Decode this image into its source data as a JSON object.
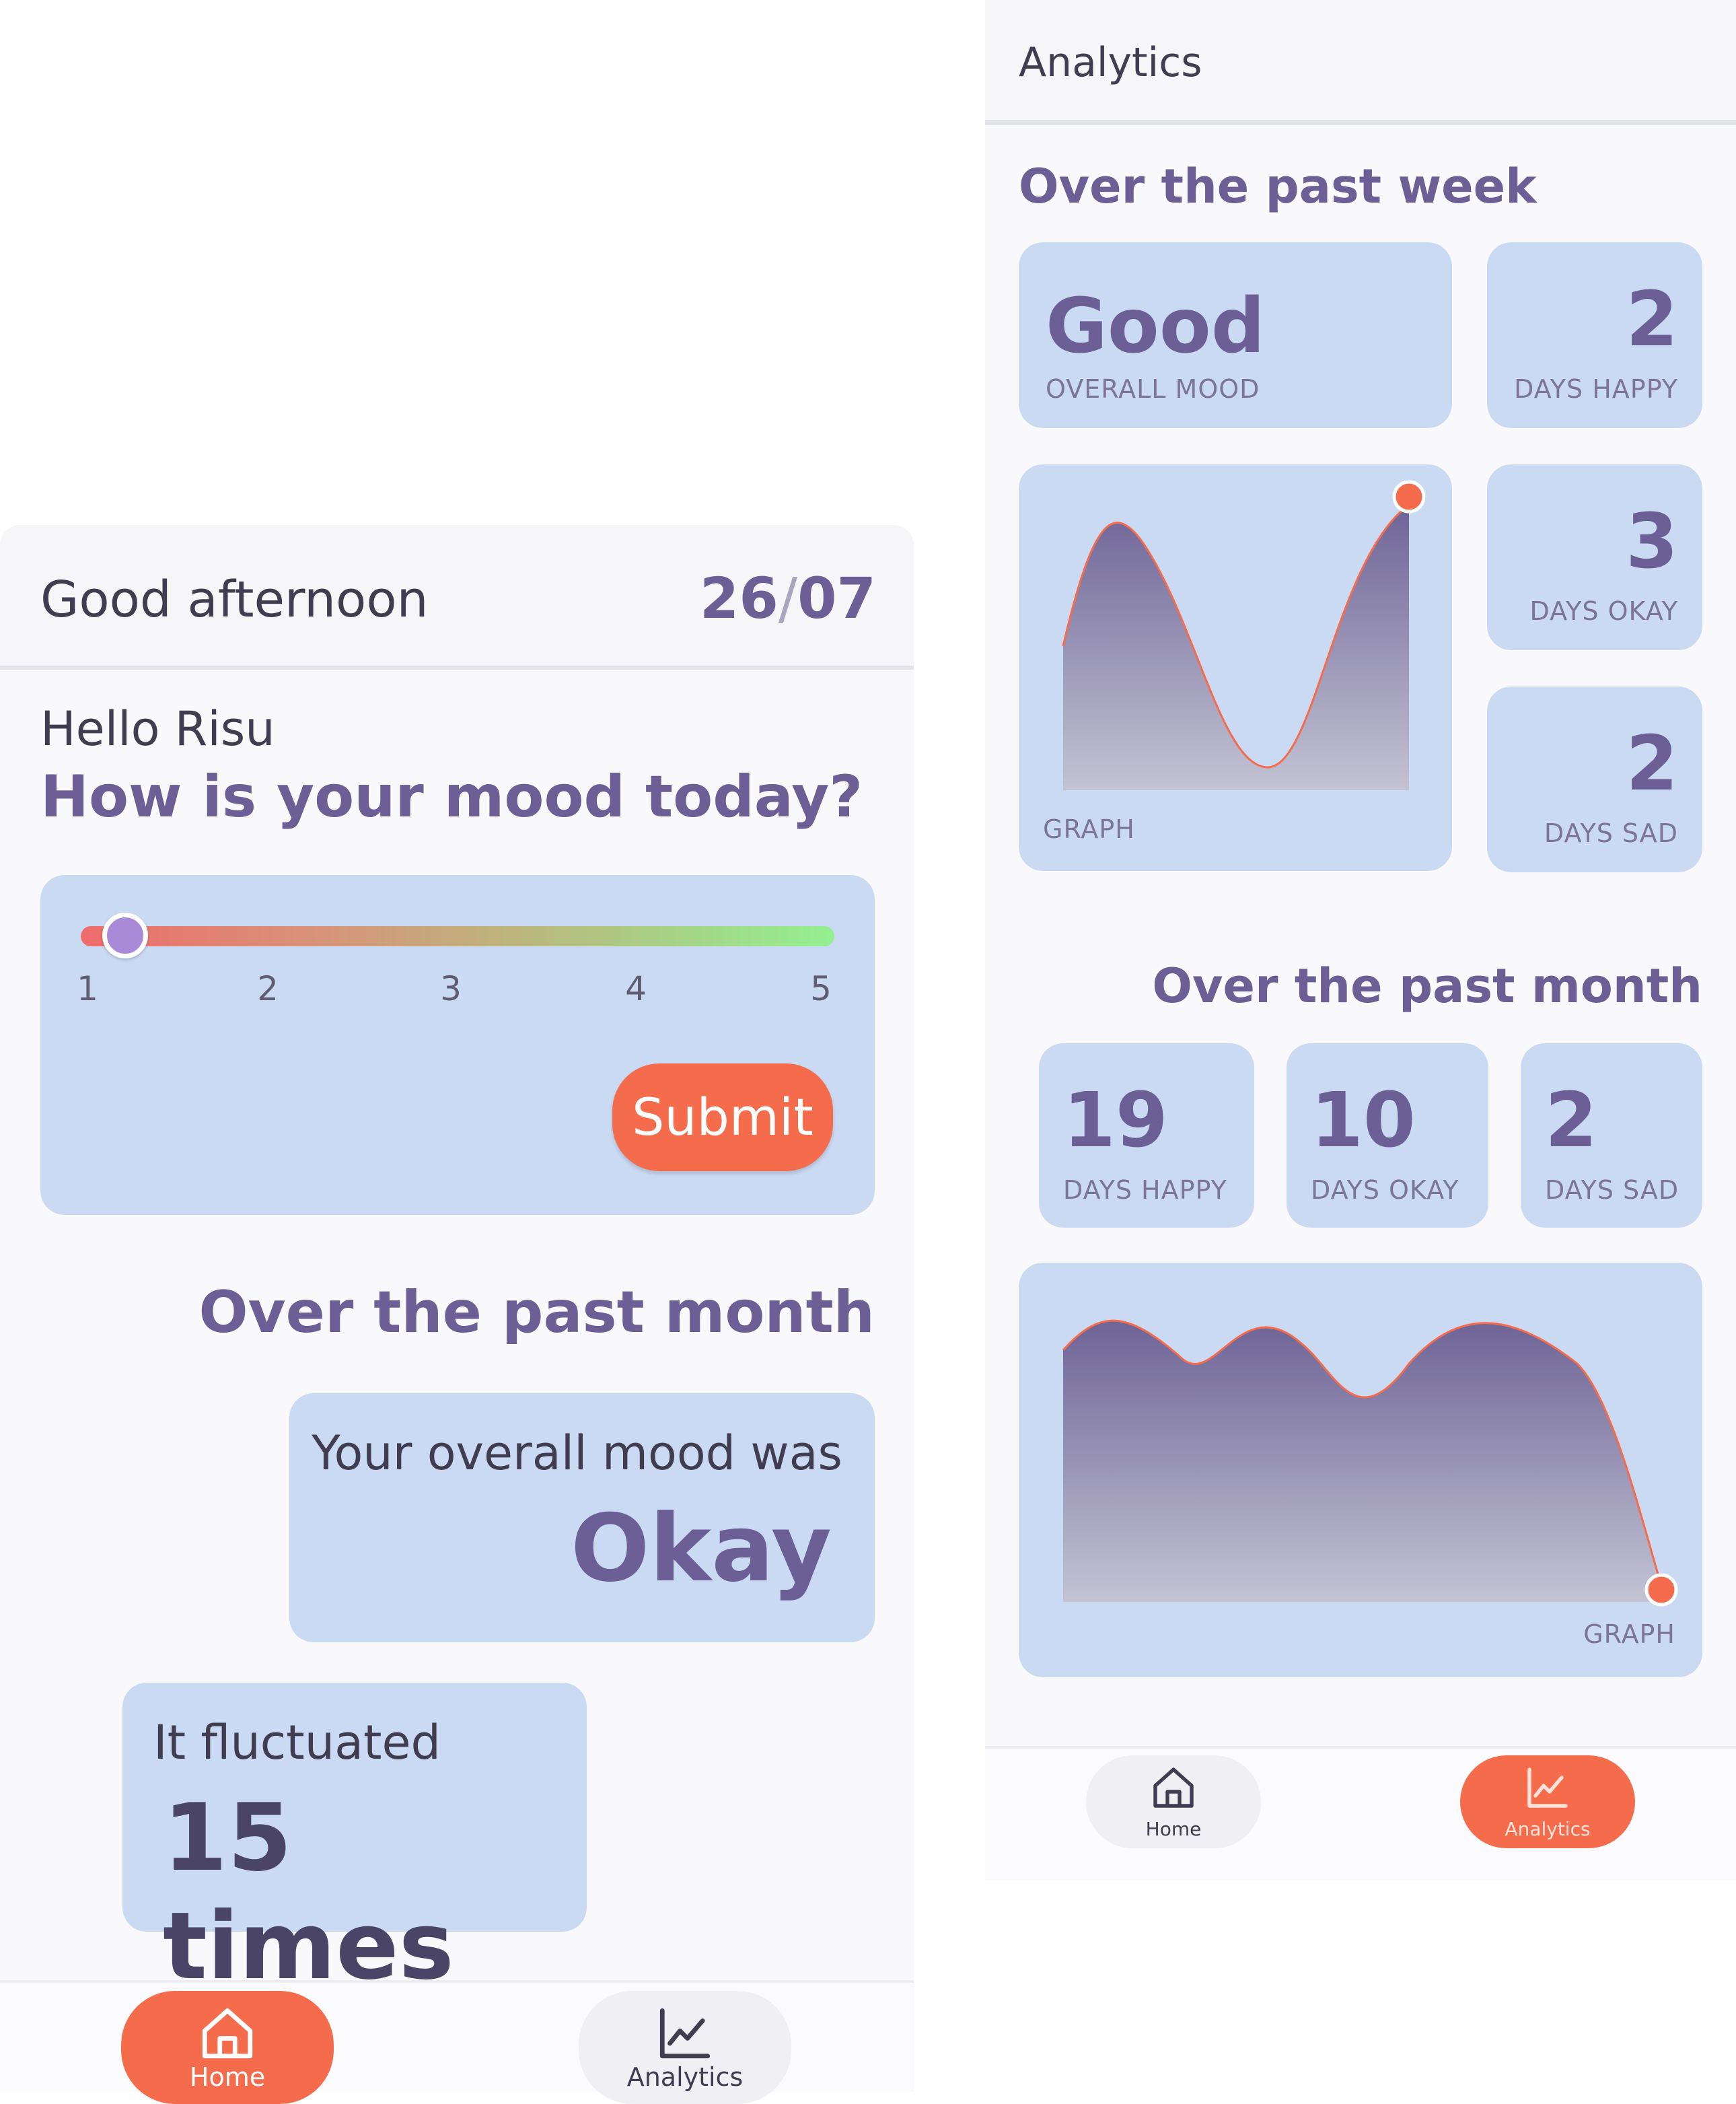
{
  "home": {
    "header": {
      "greeting": "Good afternoon",
      "date_day": "26",
      "date_sep": "/",
      "date_month": "07"
    },
    "hello": "Hello Risu",
    "question": "How is your mood today?",
    "slider": {
      "ticks": [
        "1",
        "2",
        "3",
        "4",
        "5"
      ],
      "value": 1.4,
      "min": 1,
      "max": 5
    },
    "submit_label": "Submit",
    "past_month_title": "Over the past month",
    "overall_label": "Your overall mood was",
    "overall_value": "Okay",
    "fluct_label": "It fluctuated",
    "fluct_value": "15 times",
    "nav": {
      "home_label": "Home",
      "analytics_label": "Analytics",
      "active": "home"
    }
  },
  "analytics": {
    "title": "Analytics",
    "week_title": "Over the past week",
    "overall": {
      "value": "Good",
      "label": "OVERALL MOOD"
    },
    "week_stats": [
      {
        "num": "2",
        "label": "DAYS HAPPY"
      },
      {
        "num": "3",
        "label": "DAYS OKAY"
      },
      {
        "num": "2",
        "label": "DAYS SAD"
      }
    ],
    "week_graph_label": "GRAPH",
    "month_title": "Over the past month",
    "month_stats": [
      {
        "num": "19",
        "label": "DAYS HAPPY"
      },
      {
        "num": "10",
        "label": "DAYS OKAY"
      },
      {
        "num": "2",
        "label": "DAYS SAD"
      }
    ],
    "month_graph_label": "GRAPH",
    "nav": {
      "home_label": "Home",
      "analytics_label": "Analytics",
      "active": "analytics"
    }
  },
  "colors": {
    "accent": "#f46c4c",
    "primary_text": "#6b5f96",
    "card_bg": "#cbdaf3",
    "thumb": "#a98ad9"
  }
}
